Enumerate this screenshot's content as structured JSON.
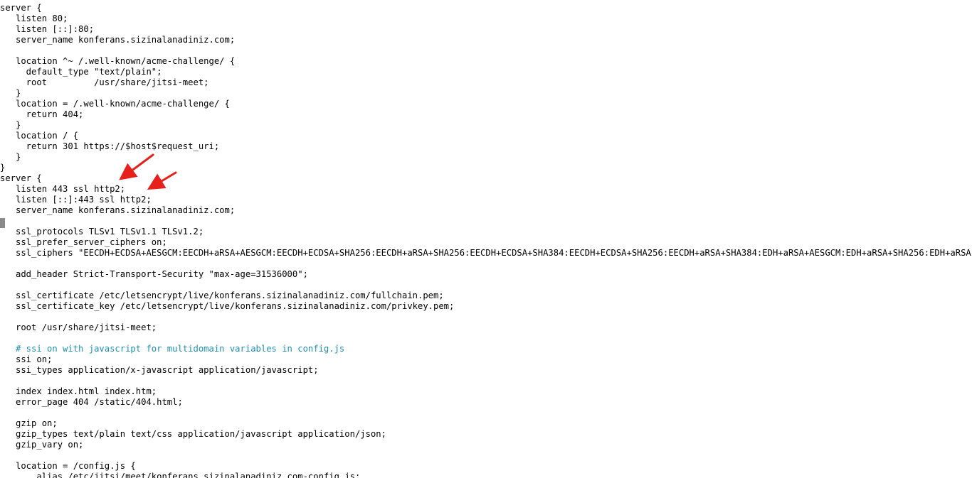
{
  "terminal": {
    "lines": [
      {
        "text": "server {",
        "comment": false
      },
      {
        "text": "   listen 80;",
        "comment": false
      },
      {
        "text": "   listen [::]:80;",
        "comment": false
      },
      {
        "text": "   server_name konferans.sizinalanadiniz.com;",
        "comment": false
      },
      {
        "text": "",
        "comment": false
      },
      {
        "text": "   location ^~ /.well-known/acme-challenge/ {",
        "comment": false
      },
      {
        "text": "     default_type \"text/plain\";",
        "comment": false
      },
      {
        "text": "     root         /usr/share/jitsi-meet;",
        "comment": false
      },
      {
        "text": "   }",
        "comment": false
      },
      {
        "text": "   location = /.well-known/acme-challenge/ {",
        "comment": false
      },
      {
        "text": "     return 404;",
        "comment": false
      },
      {
        "text": "   }",
        "comment": false
      },
      {
        "text": "   location / {",
        "comment": false
      },
      {
        "text": "     return 301 https://$host$request_uri;",
        "comment": false
      },
      {
        "text": "   }",
        "comment": false
      },
      {
        "text": "}",
        "comment": false
      },
      {
        "text": "server {",
        "comment": false
      },
      {
        "text": "   listen 443 ssl http2;",
        "comment": false
      },
      {
        "text": "   listen [::]:443 ssl http2;",
        "comment": false
      },
      {
        "text": "   server_name konferans.sizinalanadiniz.com;",
        "comment": false
      },
      {
        "text": "",
        "comment": false
      },
      {
        "text": "   ssl_protocols TLSv1 TLSv1.1 TLSv1.2;",
        "comment": false
      },
      {
        "text": "   ssl_prefer_server_ciphers on;",
        "comment": false
      },
      {
        "text": "   ssl_ciphers \"EECDH+ECDSA+AESGCM:EECDH+aRSA+AESGCM:EECDH+ECDSA+SHA256:EECDH+aRSA+SHA256:EECDH+ECDSA+SHA384:EECDH+ECDSA+SHA256:EECDH+aRSA+SHA384:EDH+aRSA+AESGCM:EDH+aRSA+SHA256:EDH+aRSA:EECDH:!",
        "comment": false
      },
      {
        "text": "",
        "comment": false
      },
      {
        "text": "   add_header Strict-Transport-Security \"max-age=31536000\";",
        "comment": false
      },
      {
        "text": "",
        "comment": false
      },
      {
        "text": "   ssl_certificate /etc/letsencrypt/live/konferans.sizinalanadiniz.com/fullchain.pem;",
        "comment": false
      },
      {
        "text": "   ssl_certificate_key /etc/letsencrypt/live/konferans.sizinalanadiniz.com/privkey.pem;",
        "comment": false
      },
      {
        "text": "",
        "comment": false
      },
      {
        "text": "   root /usr/share/jitsi-meet;",
        "comment": false
      },
      {
        "text": "",
        "comment": false
      },
      {
        "text": "   # ssi on with javascript for multidomain variables in config.js",
        "comment": true
      },
      {
        "text": "   ssi on;",
        "comment": false
      },
      {
        "text": "   ssi_types application/x-javascript application/javascript;",
        "comment": false
      },
      {
        "text": "",
        "comment": false
      },
      {
        "text": "   index index.html index.htm;",
        "comment": false
      },
      {
        "text": "   error_page 404 /static/404.html;",
        "comment": false
      },
      {
        "text": "",
        "comment": false
      },
      {
        "text": "   gzip on;",
        "comment": false
      },
      {
        "text": "   gzip_types text/plain text/css application/javascript application/json;",
        "comment": false
      },
      {
        "text": "   gzip_vary on;",
        "comment": false
      },
      {
        "text": "",
        "comment": false
      },
      {
        "text": "   location = /config.js {",
        "comment": false
      },
      {
        "text": "       alias /etc/jitsi/meet/konferans.sizinalanadiniz.com-config.js;",
        "comment": false
      }
    ]
  },
  "colors": {
    "background": "#ffffff",
    "text": "#000000",
    "comment": "#1e8fb4",
    "arrow": "#e8201c",
    "cursor": "#8a8a8a"
  }
}
